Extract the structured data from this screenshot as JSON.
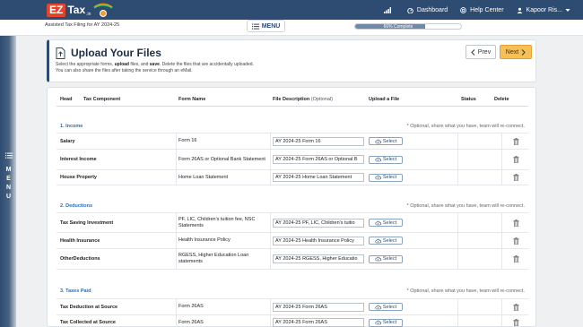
{
  "brand": {
    "ez": "EZ",
    "tax": "Tax",
    "dotin": ".in"
  },
  "topnav": {
    "dashboard": "Dashboard",
    "help": "Help Center",
    "user": "Kapoor Ris..."
  },
  "subbar": {
    "caption": "Assisted Tax Filing for AY 2024-25",
    "menu_label": "MENU",
    "progress_text": "66% Complete",
    "progress_value": 0.66
  },
  "sidemenu": {
    "letters": [
      "M",
      "E",
      "N",
      "U"
    ]
  },
  "header": {
    "title": "Upload Your Files",
    "instr_line1_a": "Select the appropriate forms, ",
    "instr_line1_b": "upload",
    "instr_line1_c": " files, and ",
    "instr_line1_d": "save",
    "instr_line1_e": ". Delete the files that are accidentally uploaded.",
    "instr_line2": "You can also share the files after taking the service through an eMail.",
    "prev_label": "Prev",
    "next_label": "Next"
  },
  "table": {
    "headers": {
      "head": "Head",
      "component": "Tax Component",
      "form": "Form Name",
      "desc": "File Description",
      "desc_opt": "(Optional)",
      "upload": "Upload a File",
      "status": "Status",
      "delete": "Delete"
    },
    "select_label": "Select",
    "sections": [
      {
        "title": "1. Income",
        "note": "* Optional, share what you have, team will re-connect.",
        "rows": [
          {
            "head": "Salary",
            "form": "Form 16",
            "desc": "AY 2024-25 Form 16"
          },
          {
            "head": "Interest Income",
            "form": "Form 26AS or Optional Bank Statement",
            "desc": "AY 2024-25 Form 26AS or Optional B"
          },
          {
            "head": "House Property",
            "form": "Home Loan Statement",
            "desc": "AY 2024-25 Home Loan Statement"
          }
        ]
      },
      {
        "title": "2. Deductions",
        "note": "* Optional, share what you have, team will re-connect.",
        "rows": [
          {
            "head": "Tax Saving Investment",
            "form": "PF, LIC, Children's tuition fee, NSC Statements",
            "desc": "AY 2024-25 PF, LIC, Children's tuitio"
          },
          {
            "head": "Health Insurance",
            "form": "Health Insurance Policy",
            "desc": "AY 2024-25 Health Insurance Policy"
          },
          {
            "head": "OtherDeductions",
            "form": "RGESS, Higher Education Loan statements",
            "desc": "AY 2024-25 RGESS, Higher Educatio"
          }
        ]
      },
      {
        "title": "3. Taxes Paid",
        "note": "* Optional, share what you have, team will re-connect.",
        "rows": [
          {
            "head": "Tax Deduction at Source",
            "form": "Form 26AS",
            "desc": "AY 2024-25 Form 26AS"
          },
          {
            "head": "Tax Collected at Source",
            "form": "Form 26AS",
            "desc": "AY 2024-25 Form 26AS"
          }
        ]
      }
    ]
  }
}
